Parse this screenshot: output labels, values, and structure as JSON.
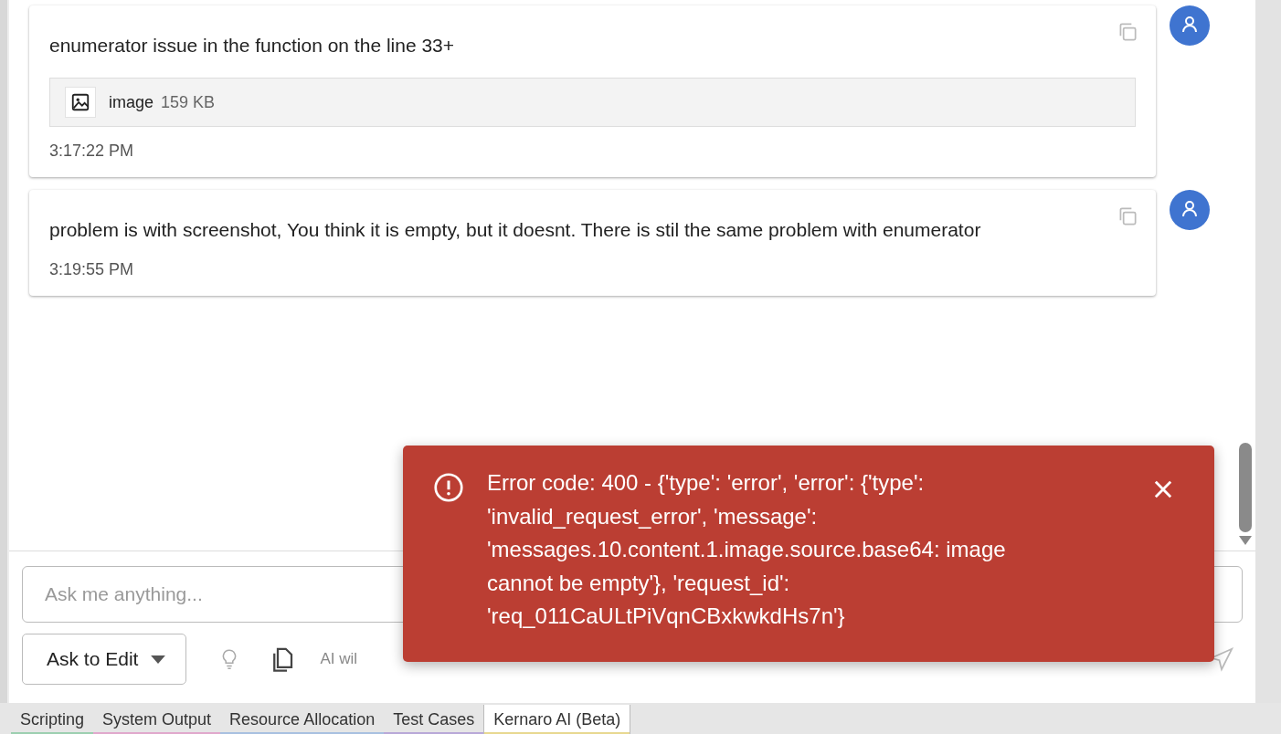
{
  "messages": [
    {
      "text": "enumerator issue in the function on the line 33+",
      "attachment": {
        "name": "image",
        "size": "159 KB"
      },
      "time": "3:17:22 PM"
    },
    {
      "text": "problem is with screenshot, You think it is empty, but it doesnt. There is stil the same problem with enumerator",
      "time": "3:19:55 PM"
    }
  ],
  "input": {
    "placeholder": "Ask me anything..."
  },
  "mode_button": {
    "label": "Ask to Edit"
  },
  "mode_hint": "AI wil",
  "error_toast": {
    "text": "Error code: 400 - {'type': 'error', 'error': {'type': 'invalid_request_error', 'message': 'messages.10.content.1.image.source.base64: image cannot be empty'}, 'request_id': 'req_011CaULtPiVqnCBxkwkdHs7n'}"
  },
  "tabs": [
    {
      "label": "Scripting",
      "selected": false,
      "color": "#9ccfb0"
    },
    {
      "label": "System Output",
      "selected": false,
      "color": "#e0a8cc"
    },
    {
      "label": "Resource Allocation",
      "selected": false,
      "color": "#a8c0e0"
    },
    {
      "label": "Test Cases",
      "selected": false,
      "color": "#b8a8d8"
    },
    {
      "label": "Kernaro AI (Beta)",
      "selected": true,
      "color": "#e8d890"
    }
  ]
}
